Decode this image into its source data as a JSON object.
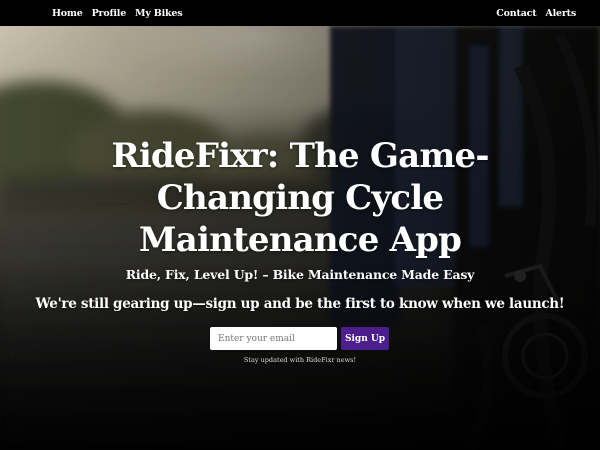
{
  "nav": {
    "left": [
      {
        "label": "Home"
      },
      {
        "label": "Profile"
      },
      {
        "label": "My Bikes"
      }
    ],
    "right": [
      {
        "label": "Contact"
      },
      {
        "label": "Alerts"
      }
    ]
  },
  "hero": {
    "headline": "RideFixr: The Game-Changing Cycle Maintenance App",
    "tagline": "Ride, Fix, Level Up! – Bike Maintenance Made Easy",
    "subline": "We're still gearing up—sign up and be the first to know when we launch!",
    "email_placeholder": "Enter your email",
    "signup_label": "Sign Up",
    "updates_note": "Stay updated with RideFixr news!"
  },
  "colors": {
    "navbar": "#000000",
    "signup_button": "#4b1e8c",
    "text": "#ffffff"
  }
}
